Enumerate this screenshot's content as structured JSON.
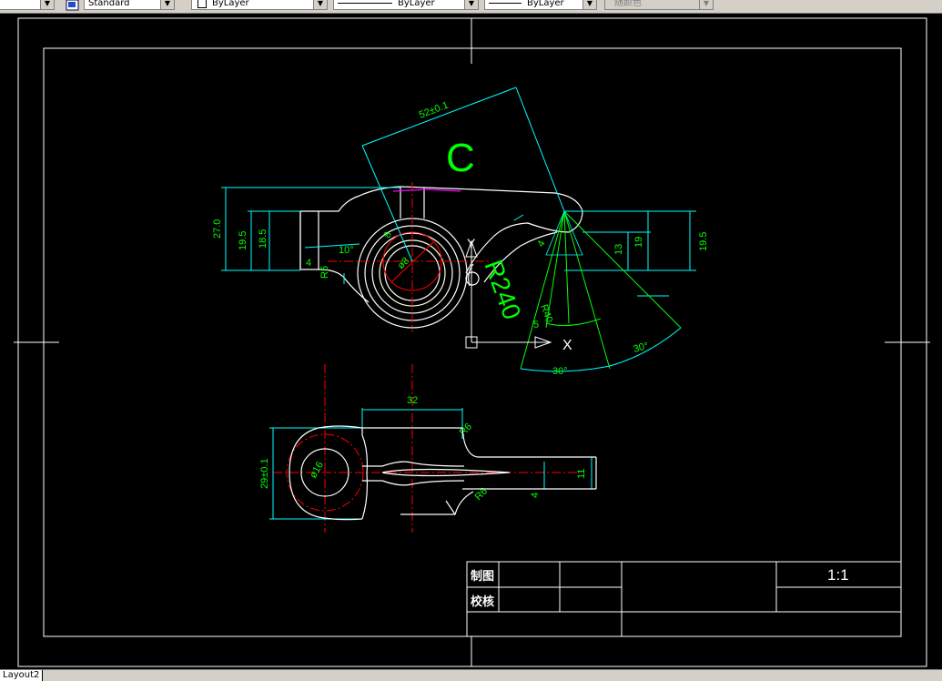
{
  "toolbar": {
    "text_style_value": "Standard",
    "layer_color_value": "ByLayer",
    "linetype_value": "ByLayer",
    "lineweight_value": "ByLayer",
    "plotstyle_value": "随颜色"
  },
  "drawing": {
    "dims": {
      "d52": "52±0.1",
      "d27": "27.0",
      "d19_5_left": "19.5",
      "d18_5": "18.5",
      "d10deg": "10°",
      "d4_left": "4",
      "dR5": "R5",
      "d8": "8",
      "dphi8": "ø8",
      "d13": "13",
      "d19": "19",
      "d19_5_right": "19.5",
      "d4_right": "4",
      "dR40": "R40",
      "d5": "5",
      "d30a": "30°",
      "d30b": "30°",
      "d32": "32",
      "d29": "29±0.1",
      "dphi16": "ø16",
      "dR6": "R6",
      "dR6b": "R6",
      "d4_bottom": "4",
      "d11": "11"
    },
    "annotations": {
      "big_c": "C",
      "big_r240": "R240",
      "ucs_y": "Y",
      "ucs_x": "X"
    }
  },
  "title_block": {
    "drawn_label": "制图",
    "checked_label": "校核",
    "scale": "1:1"
  },
  "status": {
    "layout_tab": "Layout2"
  }
}
